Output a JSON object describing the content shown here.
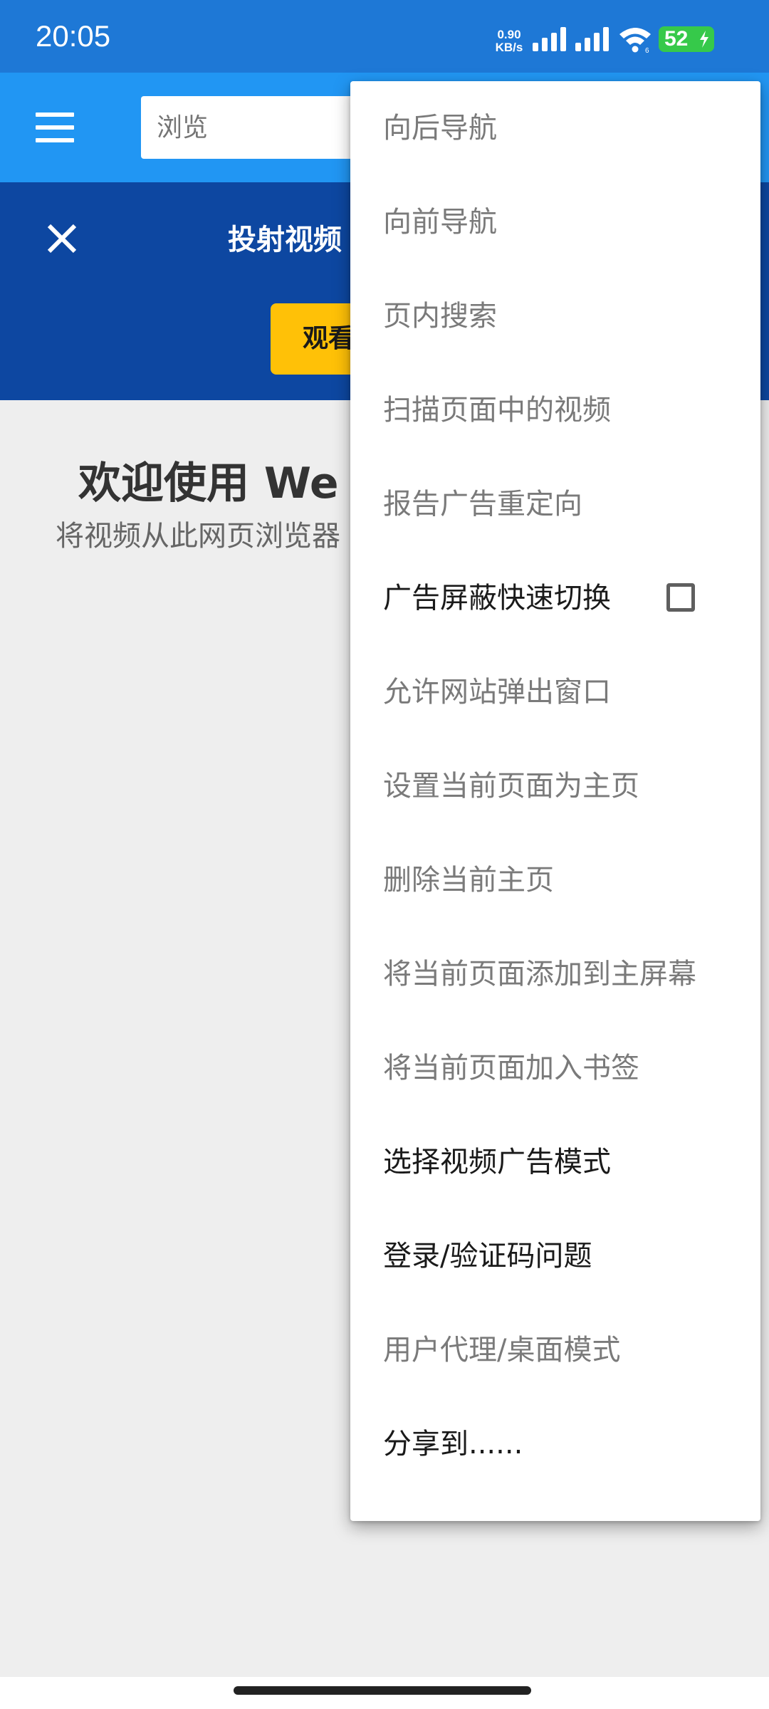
{
  "status_bar": {
    "time": "20:05",
    "net_speed_value": "0.90",
    "net_speed_unit": "KB/s",
    "battery": "52",
    "icons": [
      "signal-icon",
      "signal-icon",
      "wifi-icon",
      "battery-charging-icon"
    ]
  },
  "toolbar": {
    "menu_icon": "hamburger-icon",
    "search_placeholder": "浏览"
  },
  "cast_banner": {
    "title": "投射视频",
    "button_label": "观看"
  },
  "welcome": {
    "title": "欢迎使用 We",
    "subtitle": "将视频从此网页浏览器"
  },
  "menu": {
    "items": [
      {
        "label": "向后导航",
        "enabled": false
      },
      {
        "label": "向前导航",
        "enabled": false
      },
      {
        "label": "页内搜索",
        "enabled": false
      },
      {
        "label": "扫描页面中的视频",
        "enabled": false
      },
      {
        "label": "报告广告重定向",
        "enabled": false
      },
      {
        "label": "广告屏蔽快速切换",
        "enabled": true,
        "checkbox": true,
        "checked": false
      },
      {
        "label": "允许网站弹出窗口",
        "enabled": false
      },
      {
        "label": "设置当前页面为主页",
        "enabled": false
      },
      {
        "label": "删除当前主页",
        "enabled": false
      },
      {
        "label": "将当前页面添加到主屏幕",
        "enabled": false
      },
      {
        "label": "将当前页面加入书签",
        "enabled": false
      },
      {
        "label": "选择视频广告模式",
        "enabled": true
      },
      {
        "label": "登录/验证码问题",
        "enabled": true
      },
      {
        "label": "用户代理/桌面模式",
        "enabled": false
      },
      {
        "label": "分享到......",
        "enabled": true
      }
    ]
  },
  "colors": {
    "status_bar": "#1e78d6",
    "toolbar": "#2196f3",
    "banner": "#0d47a1",
    "accent_button": "#ffc107",
    "battery": "#36c94a"
  }
}
